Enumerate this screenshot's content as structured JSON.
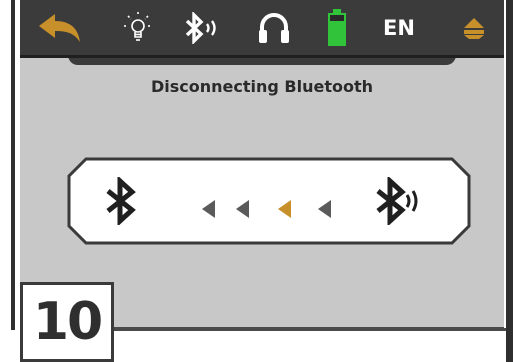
{
  "topbar": {
    "icons": [
      "back-arrow-icon",
      "light-bulb-icon",
      "bluetooth-audio-icon",
      "headphones-icon",
      "battery-icon",
      "menu-triangle-icon"
    ],
    "language": "EN"
  },
  "screen": {
    "title": "Disconnecting Bluetooth",
    "left_icon": "bluetooth-icon",
    "right_icon": "bluetooth-audio-icon",
    "arrows_active_index": 2,
    "arrow_count": 4
  },
  "step": {
    "number": "10"
  },
  "colors": {
    "accent": "#c8902a",
    "battery": "#31c43a",
    "topbar": "#3b3b3b",
    "screen_bg": "#c9c8c8"
  }
}
